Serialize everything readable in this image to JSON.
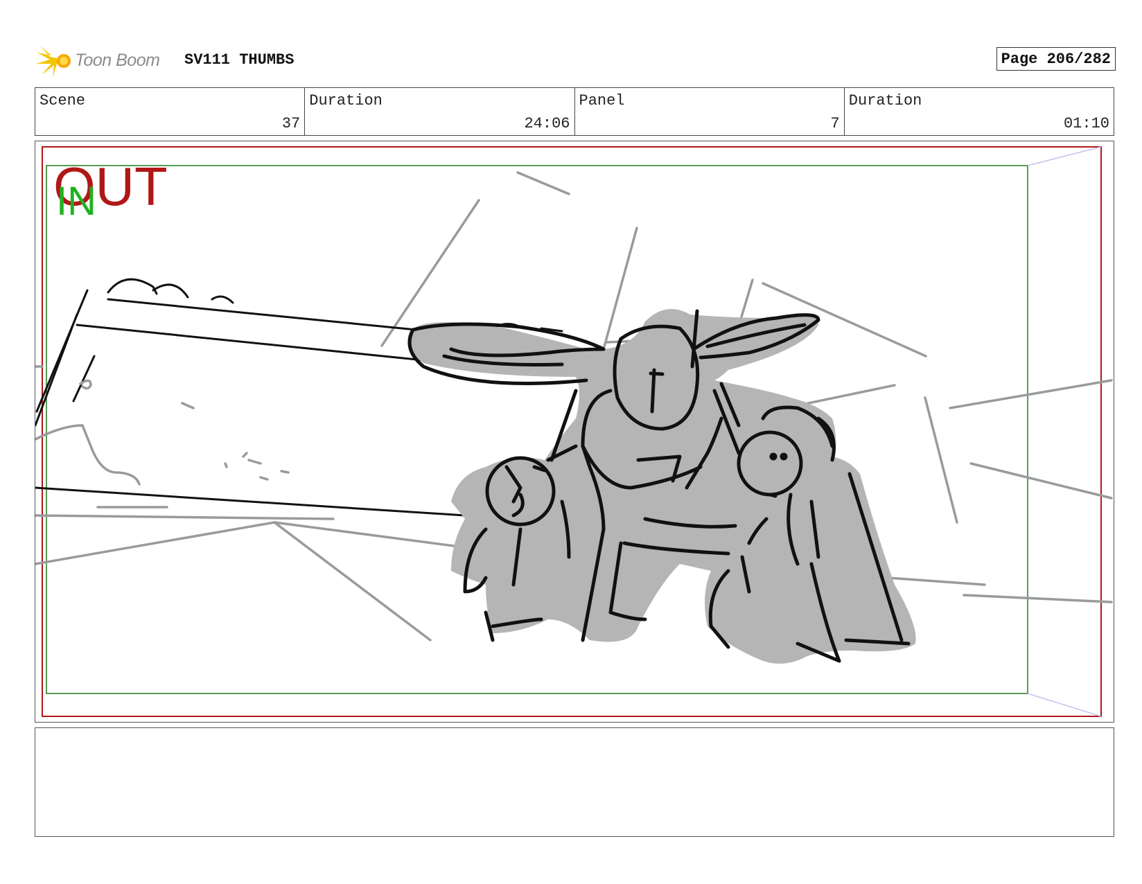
{
  "header": {
    "logo_text": "Toon Boom",
    "logo_icon": "starburst-logo-icon",
    "document_title": "SV111 THUMBS",
    "page_label": "Page 206/282"
  },
  "info": {
    "scene_label": "Scene",
    "scene_value": "37",
    "scene_duration_label": "Duration",
    "scene_duration_value": "24:06",
    "panel_label": "Panel",
    "panel_value": "7",
    "panel_duration_label": "Duration",
    "panel_duration_value": "01:10"
  },
  "panel": {
    "out_label": "OUT",
    "in_label": "IN",
    "colors": {
      "out_frame": "#b01717",
      "in_frame": "#1f7a1f",
      "in_text": "#1fb21f",
      "sketch_fill": "#b5b5b5",
      "sketch_line": "#111111",
      "guide_line": "#9a9a9a"
    }
  },
  "notes": {
    "text": ""
  }
}
